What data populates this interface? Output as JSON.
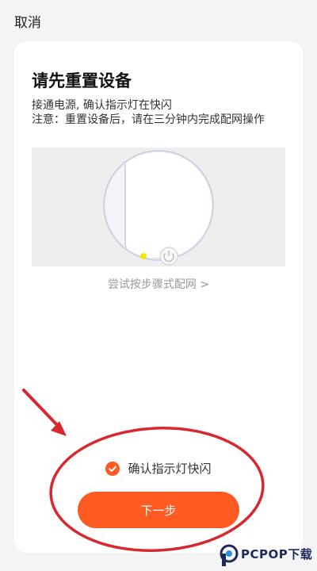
{
  "header": {
    "cancel_label": "取消"
  },
  "card": {
    "title": "请先重置设备",
    "subtitle": "接通电源, 确认指示灯在快闪",
    "note": "注意：重置设备后，请在三分钟内完成配网操作",
    "steps_link": "尝试按步骤式配网 >",
    "confirm_label": "确认指示灯快闪",
    "confirm_checked": true,
    "next_label": "下一步"
  },
  "watermark": {
    "text": "PCPOP下载"
  },
  "colors": {
    "accent": "#ff5a21",
    "annotation": "#d7282f",
    "indicator": "#f2e600"
  }
}
